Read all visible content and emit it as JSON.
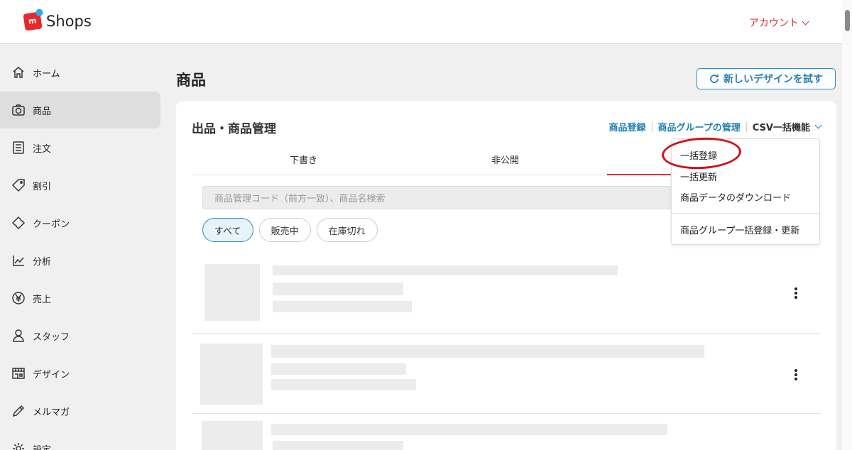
{
  "header": {
    "logo_mark": "m",
    "logo_text": "Shops",
    "account_label": "アカウント"
  },
  "sidebar": {
    "items": [
      {
        "label": "ホーム",
        "icon": "home-icon"
      },
      {
        "label": "商品",
        "icon": "camera-icon",
        "active": true
      },
      {
        "label": "注文",
        "icon": "list-icon"
      },
      {
        "label": "割引",
        "icon": "tag-icon"
      },
      {
        "label": "クーポン",
        "icon": "ticket-icon"
      },
      {
        "label": "分析",
        "icon": "chart-icon"
      },
      {
        "label": "売上",
        "icon": "yen-icon"
      },
      {
        "label": "スタッフ",
        "icon": "person-icon"
      },
      {
        "label": "デザイン",
        "icon": "store-icon"
      },
      {
        "label": "メルマガ",
        "icon": "pen-icon"
      },
      {
        "label": "設定",
        "icon": "gear-icon"
      }
    ]
  },
  "main": {
    "page_title": "商品",
    "new_design_button": "新しいデザインを試す",
    "card": {
      "title": "出品・商品管理",
      "links": {
        "register": "商品登録",
        "groups": "商品グループの管理",
        "csv": "CSV一括機能"
      },
      "tabs": [
        "下書き",
        "非公開"
      ],
      "search_placeholder": "商品管理コード（前方一致）、商品名検索",
      "filters": [
        "すべて",
        "販売中",
        "在庫切れ"
      ]
    }
  },
  "dropdown": {
    "items": [
      "一括登録",
      "一括更新",
      "商品データのダウンロード",
      "商品グループ一括登録・更新"
    ]
  },
  "colors": {
    "accent_red": "#d8323c",
    "link_blue": "#1f7fb8",
    "annotation_red": "#d0101a"
  }
}
